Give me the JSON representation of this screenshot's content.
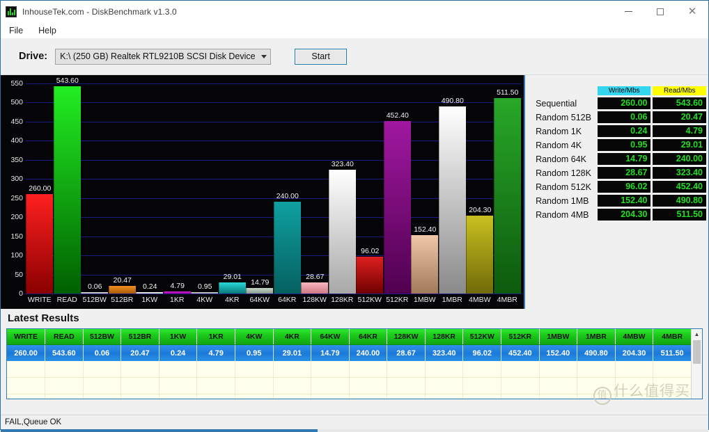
{
  "window": {
    "title": "InhouseTek.com - DiskBenchmark v1.3.0",
    "icon": "bar-chart-icon",
    "minimize": "–",
    "maximize": "□",
    "close": "✕"
  },
  "menu": {
    "items": [
      "File",
      "Help"
    ]
  },
  "toolbar": {
    "drive_label": "Drive:",
    "drive_value": "K:\\ (250 GB) Realtek RTL9210B SCSI Disk Device",
    "start_label": "Start"
  },
  "results_panel": {
    "write_header": "Write/Mbs",
    "read_header": "Read/Mbs",
    "write_header_color": "#32d6ef",
    "read_header_color": "#ffff00",
    "value_color": "#22dd22",
    "rows": [
      {
        "name": "Sequential",
        "write": "260.00",
        "read": "543.60"
      },
      {
        "name": "Random 512B",
        "write": "0.06",
        "read": "20.47"
      },
      {
        "name": "Random 1K",
        "write": "0.24",
        "read": "4.79"
      },
      {
        "name": "Random 4K",
        "write": "0.95",
        "read": "29.01"
      },
      {
        "name": "Random 64K",
        "write": "14.79",
        "read": "240.00"
      },
      {
        "name": "Random 128K",
        "write": "28.67",
        "read": "323.40"
      },
      {
        "name": "Random 512K",
        "write": "96.02",
        "read": "452.40"
      },
      {
        "name": "Random 1MB",
        "write": "152.40",
        "read": "490.80"
      },
      {
        "name": "Random 4MB",
        "write": "204.30",
        "read": "511.50"
      }
    ]
  },
  "latest_results": {
    "title": "Latest Results",
    "columns": [
      "WRITE",
      "READ",
      "512BW",
      "512BR",
      "1KW",
      "1KR",
      "4KW",
      "4KR",
      "64KW",
      "64KR",
      "128KW",
      "128KR",
      "512KW",
      "512KR",
      "1MBW",
      "1MBR",
      "4MBW",
      "4MBR"
    ],
    "rows": [
      [
        "260.00",
        "543.60",
        "0.06",
        "20.47",
        "0.24",
        "4.79",
        "0.95",
        "29.01",
        "14.79",
        "240.00",
        "28.67",
        "323.40",
        "96.02",
        "452.40",
        "152.40",
        "490.80",
        "204.30",
        "511.50"
      ]
    ],
    "empty_row_count": 4,
    "scroll_up_icon": "chevron-up-icon"
  },
  "statusbar": {
    "text": "FAIL,Queue OK"
  },
  "watermark": {
    "mark": "值",
    "text": "什么值得买"
  },
  "chart_data": {
    "type": "bar",
    "title": "",
    "xlabel": "",
    "ylabel": "",
    "ylim": [
      0,
      550
    ],
    "yticks": [
      0,
      50,
      100,
      150,
      200,
      250,
      300,
      350,
      400,
      450,
      500,
      550
    ],
    "grid": true,
    "background": "#050508",
    "gridline_color": "#1a1a80",
    "categories": [
      "WRITE",
      "READ",
      "512BW",
      "512BR",
      "1KW",
      "1KR",
      "4KW",
      "4KR",
      "64KW",
      "64KR",
      "128KW",
      "128KR",
      "512KW",
      "512KR",
      "1MBW",
      "1MBR",
      "4MBW",
      "4MBR"
    ],
    "values": [
      260.0,
      543.6,
      0.06,
      20.47,
      0.24,
      4.79,
      0.95,
      29.01,
      14.79,
      240.0,
      28.67,
      323.4,
      96.02,
      452.4,
      152.4,
      490.8,
      204.3,
      511.5
    ],
    "labels": [
      "260.00",
      "543.60",
      "0.06",
      "20.47",
      "0.24",
      "4.79",
      "0.95",
      "29.01",
      "14.79",
      "240.00",
      "28.67",
      "323.40",
      "96.02",
      "452.40",
      "152.40",
      "490.80",
      "204.30",
      "511.50"
    ],
    "bar_colors_top": [
      "#ff2020",
      "#22ee22",
      "#e8e8e8",
      "#f09020",
      "#ffffff",
      "#e820e8",
      "#dcdcdc",
      "#28d8d8",
      "#c8d8c8",
      "#0fa0a0",
      "#f8b8c0",
      "#ffffff",
      "#e02020",
      "#a018a0",
      "#f0c8a8",
      "#ffffff",
      "#c8c020",
      "#28a828"
    ],
    "bar_colors_bottom": [
      "#8a0000",
      "#006000",
      "#a8a8a8",
      "#a85a08",
      "#c8c8c8",
      "#900090",
      "#9a9a9a",
      "#0a7878",
      "#8a9a8a",
      "#066060",
      "#d07886",
      "#a8a8a8",
      "#700000",
      "#500050",
      "#a07a58",
      "#8a8a8a",
      "#706a08",
      "#0d5a0d"
    ]
  }
}
